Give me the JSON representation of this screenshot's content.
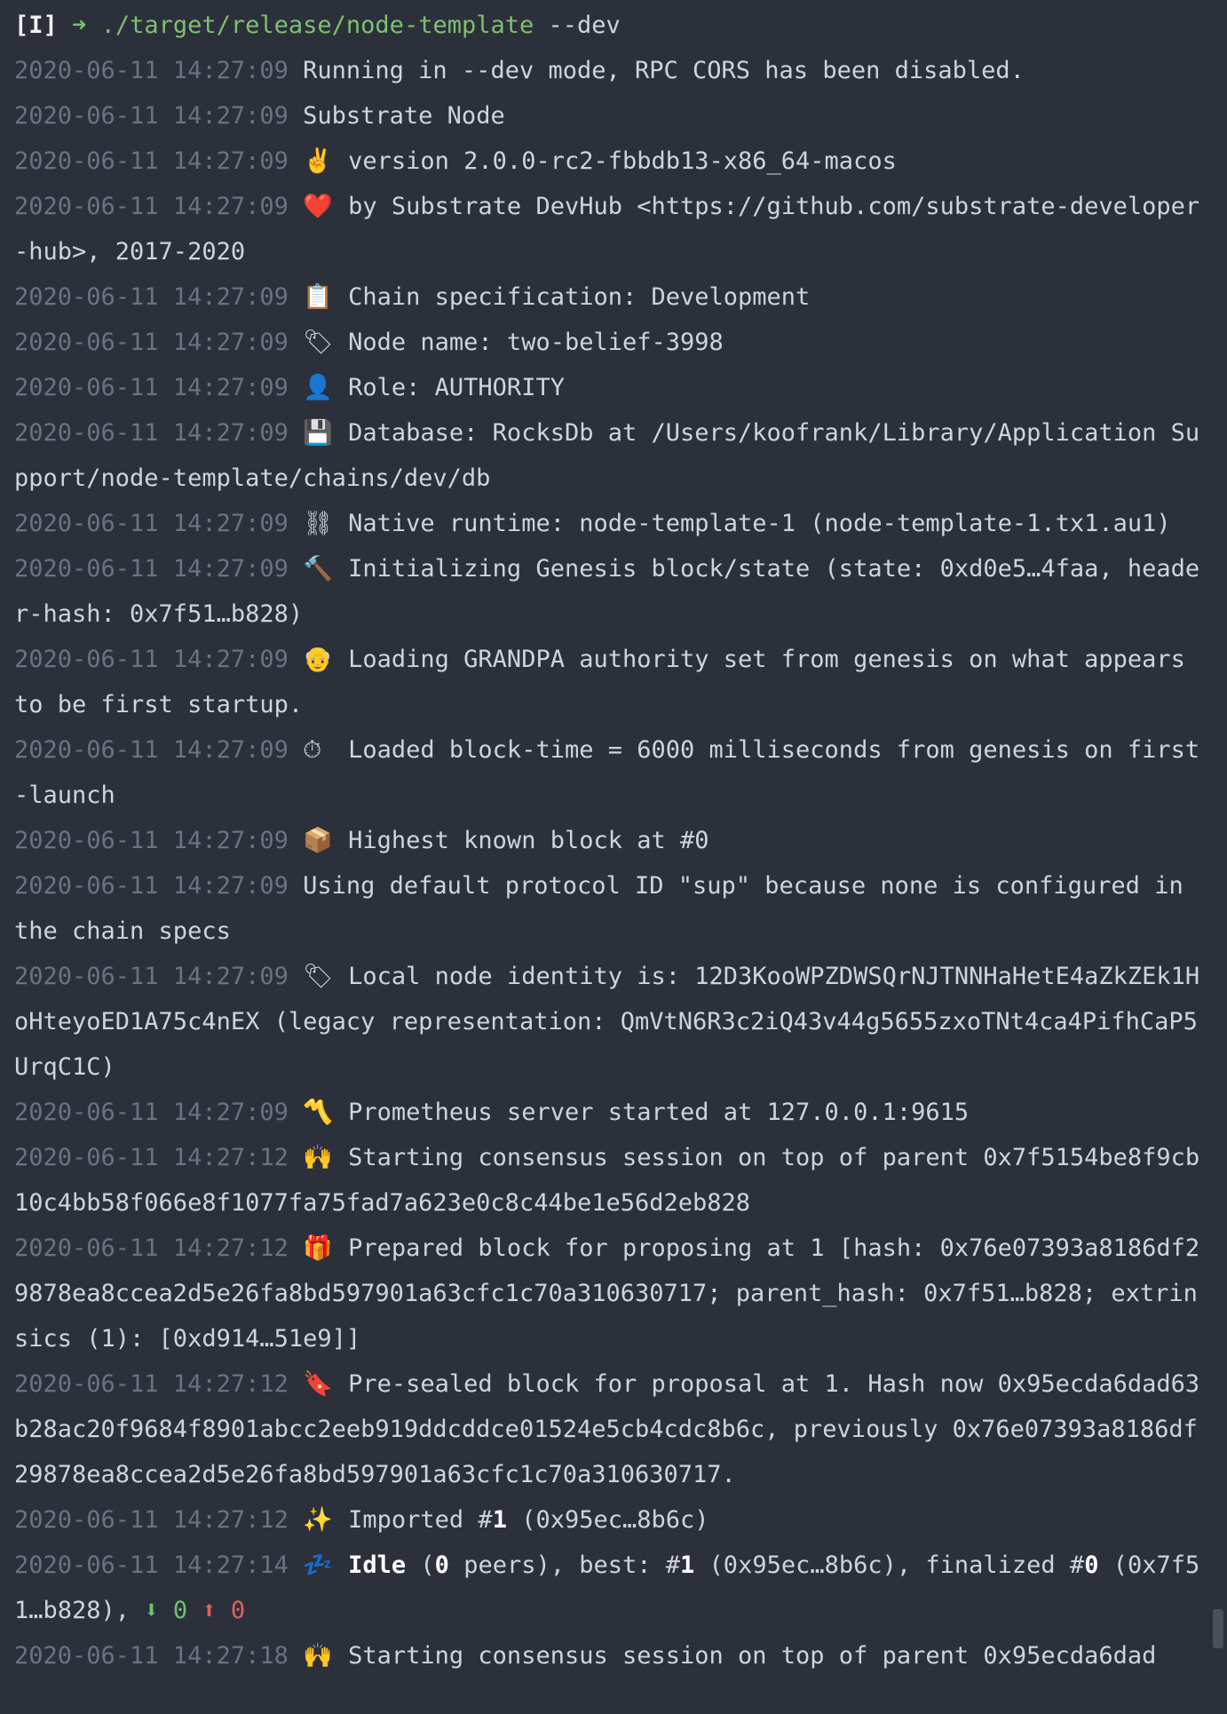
{
  "prompt": {
    "mode": "[I]",
    "arrow": "➜",
    "command": "./target/release/node-template",
    "args": "--dev"
  },
  "log": [
    {
      "ts": "2020-06-11 14:27:09",
      "icon": "",
      "icon_name": "",
      "text": "Running in --dev mode, RPC CORS has been disabled."
    },
    {
      "ts": "2020-06-11 14:27:09",
      "icon": "",
      "icon_name": "",
      "text": "Substrate Node"
    },
    {
      "ts": "2020-06-11 14:27:09",
      "icon": "✌️",
      "icon_name": "victory-hand-icon",
      "text": "version 2.0.0-rc2-fbbdb13-x86_64-macos"
    },
    {
      "ts": "2020-06-11 14:27:09",
      "icon": "❤️",
      "icon_name": "heart-icon",
      "text": "by Substrate DevHub <https://github.com/substrate-developer-hub>, 2017-2020"
    },
    {
      "ts": "2020-06-11 14:27:09",
      "icon": "📋",
      "icon_name": "clipboard-icon",
      "text": "Chain specification: Development"
    },
    {
      "ts": "2020-06-11 14:27:09",
      "icon": "🏷",
      "icon_name": "label-tag-icon",
      "text": "Node name: two-belief-3998"
    },
    {
      "ts": "2020-06-11 14:27:09",
      "icon": "👤",
      "icon_name": "user-icon",
      "text": "Role: AUTHORITY"
    },
    {
      "ts": "2020-06-11 14:27:09",
      "icon": "💾",
      "icon_name": "floppy-disk-icon",
      "text": "Database: RocksDb at /Users/koofrank/Library/Application Support/node-template/chains/dev/db"
    },
    {
      "ts": "2020-06-11 14:27:09",
      "icon": "⛓",
      "icon_name": "chains-icon",
      "text": "Native runtime: node-template-1 (node-template-1.tx1.au1)"
    },
    {
      "ts": "2020-06-11 14:27:09",
      "icon": "🔨",
      "icon_name": "hammer-icon",
      "text": "Initializing Genesis block/state (state: 0xd0e5…4faa, header-hash: 0x7f51…b828)"
    },
    {
      "ts": "2020-06-11 14:27:09",
      "icon": "👴",
      "icon_name": "old-man-icon",
      "text": "Loading GRANDPA authority set from genesis on what appears to be first startup."
    },
    {
      "ts": "2020-06-11 14:27:09",
      "icon": "⏱",
      "icon_name": "stopwatch-icon",
      "text": "Loaded block-time = 6000 milliseconds from genesis on first-launch"
    },
    {
      "ts": "2020-06-11 14:27:09",
      "icon": "📦",
      "icon_name": "package-icon",
      "text": "Highest known block at #0"
    },
    {
      "ts": "2020-06-11 14:27:09",
      "icon": "",
      "icon_name": "",
      "text": "Using default protocol ID \"sup\" because none is configured in the chain specs"
    },
    {
      "ts": "2020-06-11 14:27:09",
      "icon": "🏷",
      "icon_name": "label-tag-icon",
      "text": "Local node identity is: 12D3KooWPZDWSQrNJTNNHaHetE4aZkZEk1HoHteyoED1A75c4nEX (legacy representation: QmVtN6R3c2iQ43v44g5655zxoTNt4ca4PifhCaP5UrqC1C)"
    },
    {
      "ts": "2020-06-11 14:27:09",
      "icon": "〽️",
      "icon_name": "part-alternation-mark-icon",
      "text": "Prometheus server started at 127.0.0.1:9615"
    },
    {
      "ts": "2020-06-11 14:27:12",
      "icon": "🙌",
      "icon_name": "raising-hands-icon",
      "text": "Starting consensus session on top of parent 0x7f5154be8f9cb10c4bb58f066e8f1077fa75fad7a623e0c8c44be1e56d2eb828"
    },
    {
      "ts": "2020-06-11 14:27:12",
      "icon": "🎁",
      "icon_name": "gift-icon",
      "text": "Prepared block for proposing at 1 [hash: 0x76e07393a8186df29878ea8ccea2d5e26fa8bd597901a63cfc1c70a310630717; parent_hash: 0x7f51…b828; extrinsics (1): [0xd914…51e9]]"
    },
    {
      "ts": "2020-06-11 14:27:12",
      "icon": "🔖",
      "icon_name": "bookmark-icon",
      "text": "Pre-sealed block for proposal at 1. Hash now 0x95ecda6dad63b28ac20f9684f8901abcc2eeb919ddcddce01524e5cb4cdc8b6c, previously 0x76e07393a8186df29878ea8ccea2d5e26fa8bd597901a63cfc1c70a310630717."
    }
  ],
  "imported": {
    "ts": "2020-06-11 14:27:12",
    "icon": "✨",
    "text_a": "Imported #",
    "num": "1",
    "text_b": " (0x95ec…8b6c)"
  },
  "idle": {
    "ts": "2020-06-11 14:27:14",
    "icon": "💤",
    "label": "Idle",
    "text_a": " (",
    "peers": "0",
    "text_b": " peers), best: #",
    "best": "1",
    "text_c": " (0x95ec…8b6c), finalized #",
    "finalized": "0",
    "text_d": " (0x7f51…b828), ",
    "down_arrow": "⬇",
    "down_val": "0",
    "up_arrow": "⬆",
    "up_val": "0"
  },
  "last": {
    "ts": "2020-06-11 14:27:18",
    "icon": "🙌",
    "text": "Starting consensus session on top of parent 0x95ecda6dad"
  }
}
